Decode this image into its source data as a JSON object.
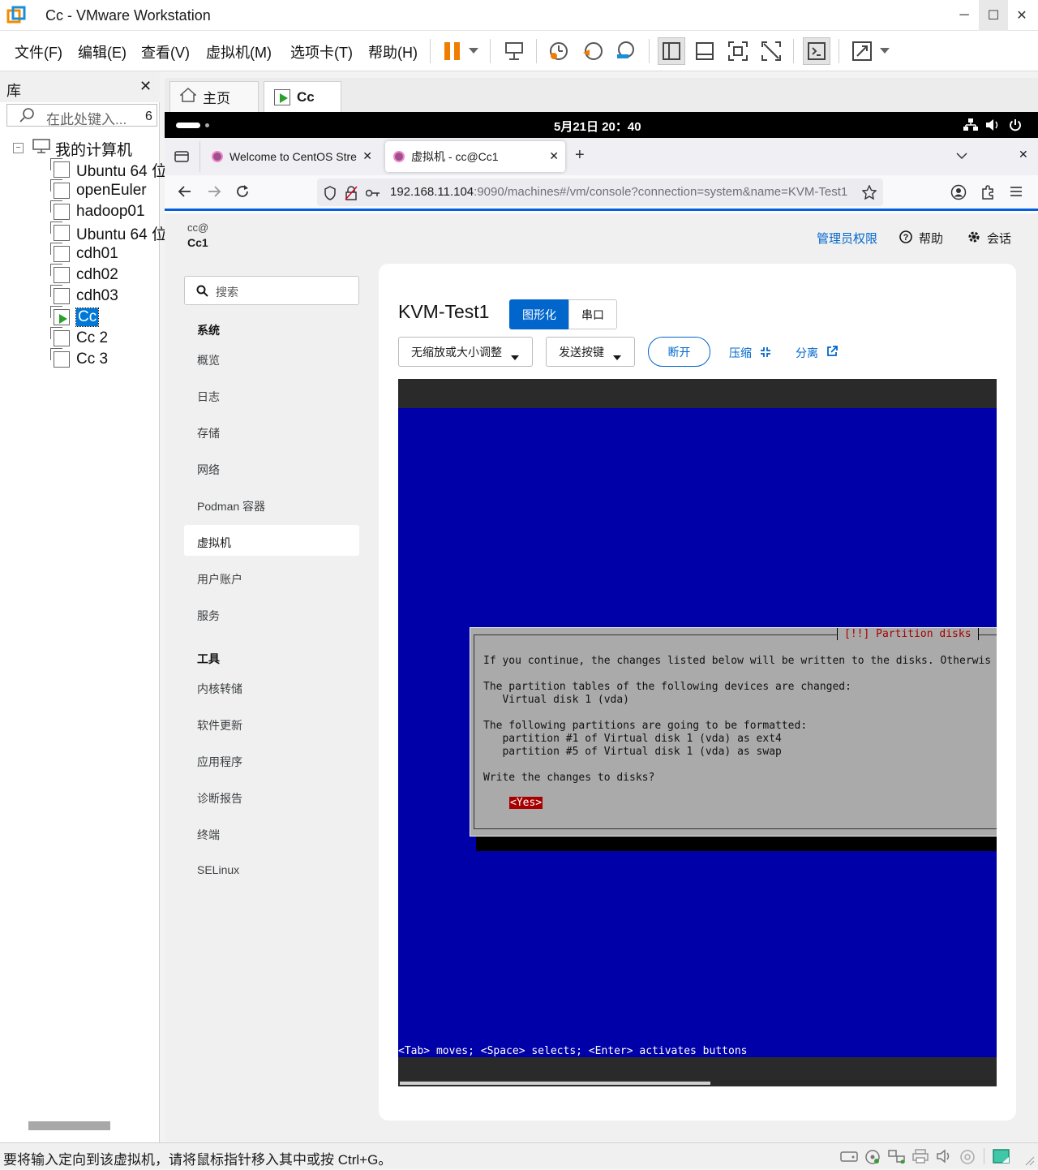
{
  "window": {
    "title": "Cc - VMware Workstation",
    "minimize": "─",
    "maximize": "☐",
    "close": "✕"
  },
  "menu": [
    "文件(F)",
    "编辑(E)",
    "查看(V)",
    "虚拟机(M)",
    "选项卡(T)",
    "帮助(H)"
  ],
  "library": {
    "title": "库",
    "close": "✕",
    "search_placeholder": "在此处键入...",
    "search_count": "6",
    "root": "我的计算机",
    "vms": [
      "Ubuntu 64 位",
      "openEuler",
      "hadoop01",
      "Ubuntu 64 位",
      "cdh01",
      "cdh02",
      "cdh03",
      "Cc",
      "Cc 2",
      "Cc 3"
    ],
    "selected_vm": "Cc"
  },
  "vm_tabs": [
    {
      "label": "主页",
      "icon": "home-icon"
    },
    {
      "label": "Cc",
      "icon": "vm-running-icon"
    }
  ],
  "gnome": {
    "clock": "5月21日  20：40"
  },
  "firefox": {
    "tabs": [
      {
        "label": "Welcome to CentOS Stre"
      },
      {
        "label": "虚拟机 - cc@Cc1"
      }
    ],
    "url_host": "192.168.11.104",
    "url_rest": ":9090/machines#/vm/console?connection=system&name=KVM-Test1",
    "accent": "#0060df"
  },
  "cockpit": {
    "user": "cc@",
    "host": "Cc1",
    "admin_link": "管理员权限",
    "help": "帮助",
    "session": "会话",
    "search_placeholder": "搜索",
    "system_header": "系统",
    "system_items": [
      "概览",
      "日志",
      "存储",
      "网络",
      "Podman 容器",
      "虚拟机",
      "用户账户",
      "服务"
    ],
    "tools_header": "工具",
    "tools_items": [
      "内核转储",
      "软件更新",
      "应用程序",
      "诊断报告",
      "终端",
      "SELinux"
    ],
    "active_item": "虚拟机",
    "vm_name": "KVM-Test1",
    "tab_graphics": "图形化",
    "tab_serial": "串口",
    "scale_dropdown": "无缩放或大小调整",
    "send_key_dropdown": "发送按键",
    "disconnect": "断开",
    "compress": "压缩",
    "detach": "分离",
    "accent": "#0066cc"
  },
  "console": {
    "dialog_title": "[!!] Partition disks",
    "lines": [
      "If you continue, the changes listed below will be written to the disks. Otherwis",
      "",
      "The partition tables of the following devices are changed:",
      "   Virtual disk 1 (vda)",
      "",
      "The following partitions are going to be formatted:",
      "   partition #1 of Virtual disk 1 (vda) as ext4",
      "   partition #5 of Virtual disk 1 (vda) as swap",
      "",
      "Write the changes to disks?"
    ],
    "yes_button": "<Yes>",
    "help_line": "<Tab> moves; <Space> selects; <Enter> activates buttons",
    "background": "#0000a8"
  },
  "status": {
    "text": "要将输入定向到该虚拟机，请将鼠标指针移入其中或按 Ctrl+G。"
  }
}
